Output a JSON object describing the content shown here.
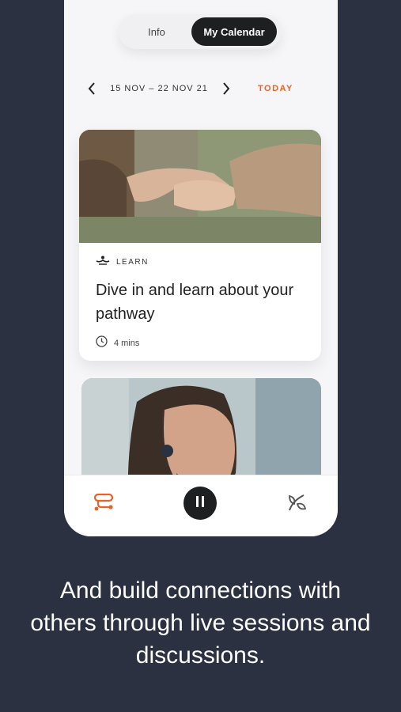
{
  "segmented": {
    "info_label": "Info",
    "calendar_label": "My Calendar"
  },
  "datebar": {
    "range": "15 NOV – 22 NOV 21",
    "today_label": "TODAY"
  },
  "card": {
    "category": "LEARN",
    "title": "Dive in and learn about your pathway",
    "duration": "4 mins",
    "category_icon": "learn-icon",
    "duration_icon": "clock-icon"
  },
  "tabbar": {
    "icons": [
      "pathway-icon",
      "pause-icon",
      "leaf-icon"
    ]
  },
  "caption": "And build connections with others through live sessions and discussions.",
  "colors": {
    "accent": "#e8632b",
    "background": "#2b3140",
    "dark": "#1e1f21"
  }
}
